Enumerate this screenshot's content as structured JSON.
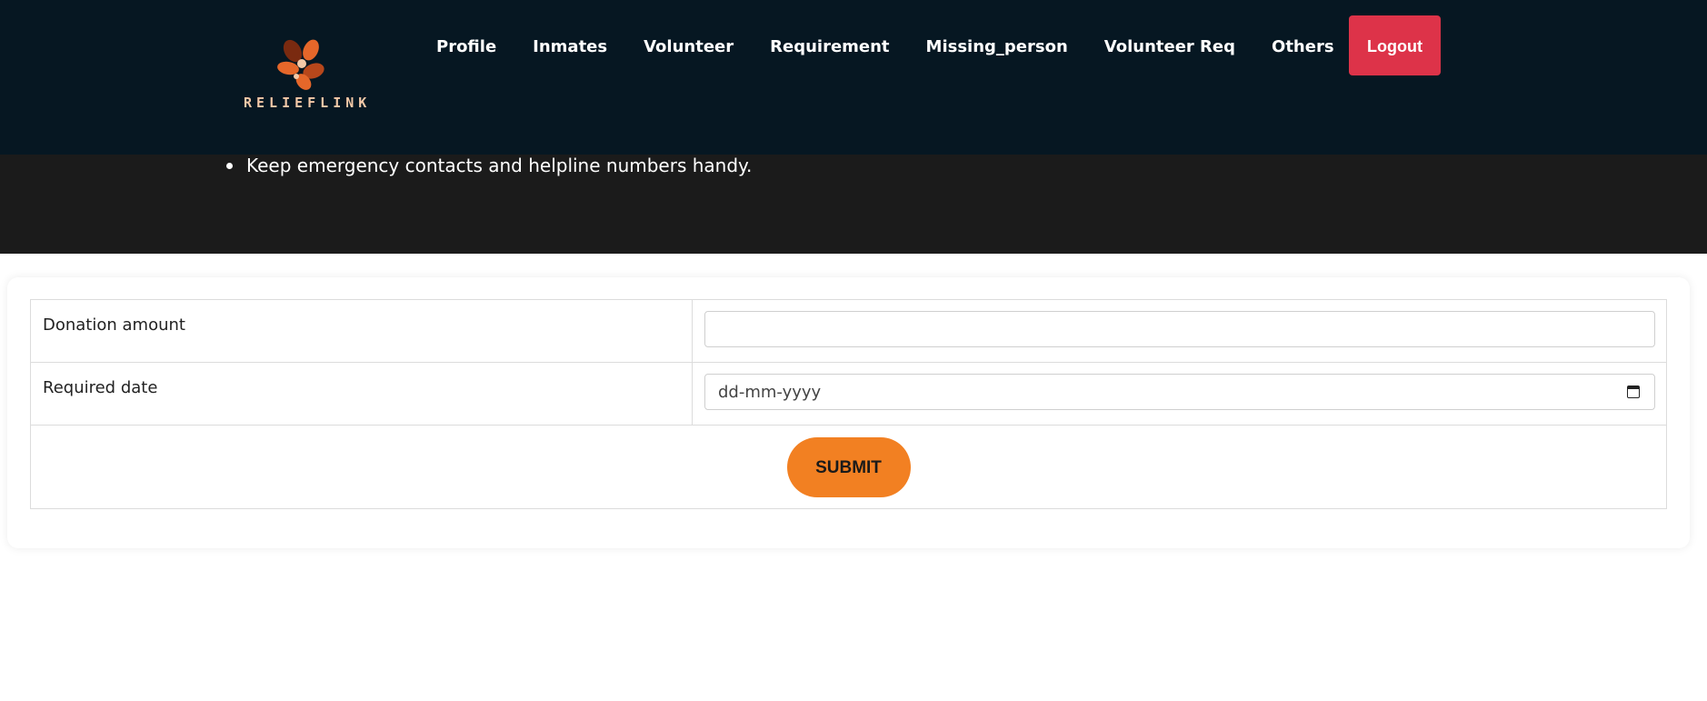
{
  "brand": {
    "logo_text": "RELIEFLINK",
    "logo_colors": [
      "#e5672a",
      "#b7471b",
      "#7a2a10",
      "#f4c9a8"
    ]
  },
  "nav": {
    "items": [
      {
        "label": "Profile"
      },
      {
        "label": "Inmates"
      },
      {
        "label": "Volunteer"
      },
      {
        "label": "Requirement"
      },
      {
        "label": "Missing_person"
      },
      {
        "label": "Volunteer Req"
      },
      {
        "label": "Others"
      }
    ],
    "logout_label": "Logout"
  },
  "tips": {
    "items": [
      "Keep emergency contacts and helpline numbers handy."
    ]
  },
  "form": {
    "donation_label": "Donation amount",
    "donation_value": "",
    "date_label": "Required date",
    "date_placeholder": "dd-mm-yyyy",
    "date_icon": "calendar-icon",
    "submit_label": "SUBMIT"
  },
  "colors": {
    "header_bg": "#061722",
    "tips_bg": "#1b1b1b",
    "logout_bg": "#dd3349",
    "submit_bg": "#f28022"
  }
}
